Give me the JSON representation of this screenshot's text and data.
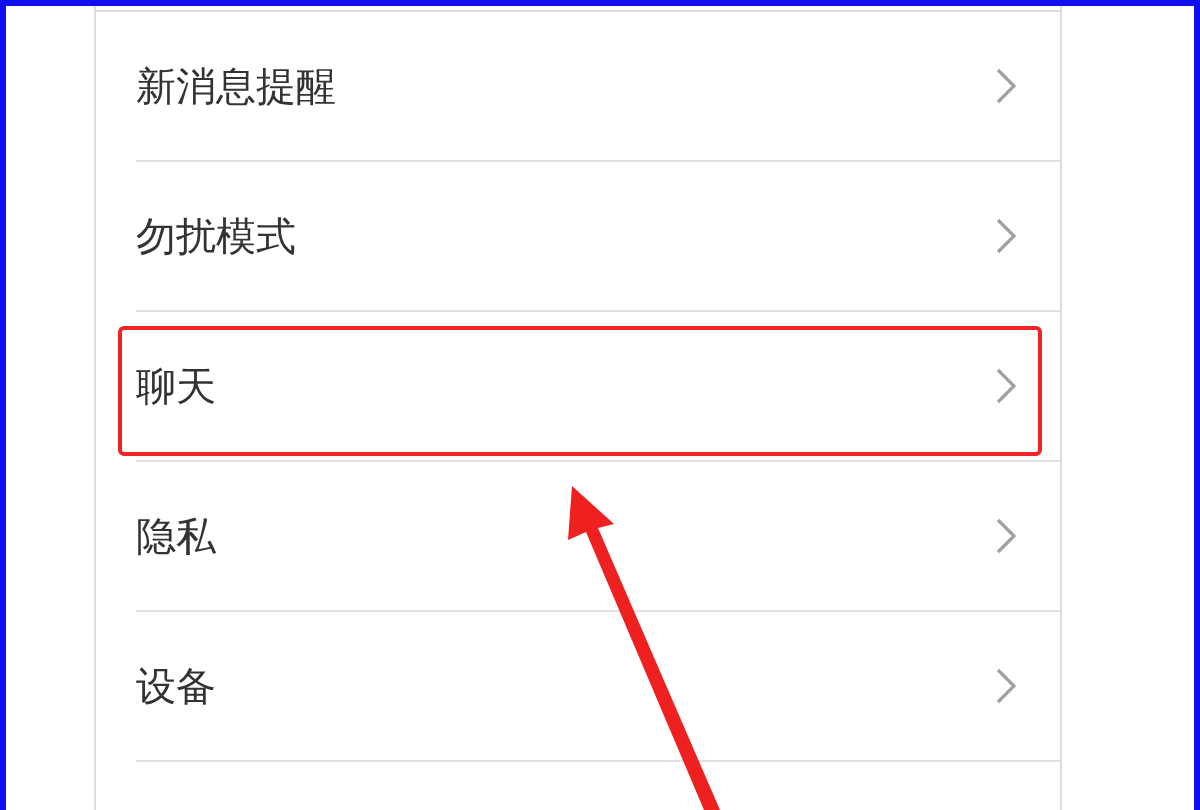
{
  "settings": {
    "items": [
      {
        "label": "新消息提醒",
        "highlighted": false
      },
      {
        "label": "勿扰模式",
        "highlighted": false
      },
      {
        "label": "聊天",
        "highlighted": true
      },
      {
        "label": "隐私",
        "highlighted": false
      },
      {
        "label": "设备",
        "highlighted": false
      }
    ]
  }
}
